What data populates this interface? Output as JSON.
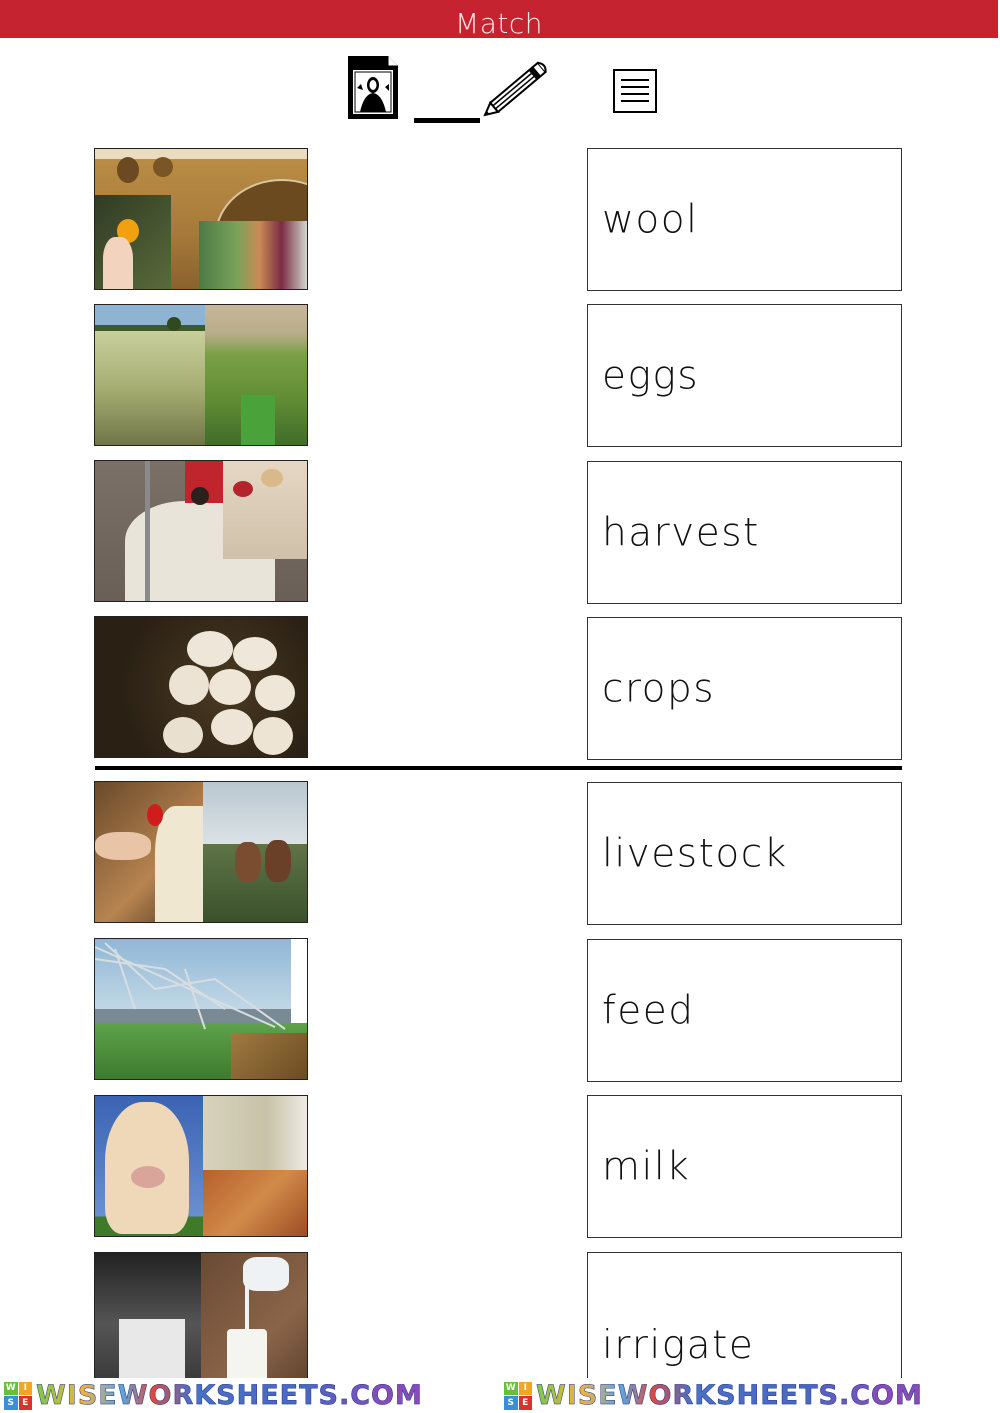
{
  "header": {
    "title": "Match"
  },
  "instructions": {
    "icons": [
      "picture-document-icon",
      "write-line-pencil-icon",
      "text-document-icon"
    ]
  },
  "pictures": [
    {
      "name": "harvest-crops-collage",
      "description": "hay bales, picking orange, basket of vegetables"
    },
    {
      "name": "crop-fields-collage",
      "description": "wheat field and vineyard"
    },
    {
      "name": "wool-collage",
      "description": "sheep shearing and yarn/knitting"
    },
    {
      "name": "eggs-photo",
      "description": "eggs in straw nest"
    },
    {
      "name": "feed-collage",
      "description": "feeding a chicken and horses"
    },
    {
      "name": "irrigate-collage",
      "description": "irrigation sprinkler system and channel"
    },
    {
      "name": "livestock-collage",
      "description": "cow, sheep and hens"
    },
    {
      "name": "milk-collage",
      "description": "milking cow and pouring milk into glass"
    }
  ],
  "words": [
    "wool",
    "eggs",
    "harvest",
    "crops",
    "livestock",
    "feed",
    "milk",
    "irrigate"
  ],
  "footer": {
    "brand": "WISEWORKSHEETS.COM",
    "logo_letters": [
      "W",
      "I",
      "S",
      "E"
    ]
  },
  "colors": {
    "header_bg": "#c4232f",
    "header_text": "#fde8ea",
    "logo": [
      "#6abf3a",
      "#f2a623",
      "#3a8fd6",
      "#d9342b"
    ]
  }
}
